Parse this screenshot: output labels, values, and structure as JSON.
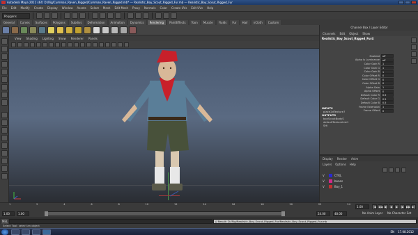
{
  "window": {
    "title": "Autodesk Maya 2011 x64: D:/Rig/Cumman_Raven_Rigged/Cumman_Raven_Rigged.mb* --- Realistic_Boy_Scout_Rigged_Fur.mb --- Realistic_Boy_Scout_Rigged_Fur",
    "controls": [
      "minimize",
      "maximize",
      "close"
    ]
  },
  "menubar": [
    "File",
    "Edit",
    "Modify",
    "Create",
    "Display",
    "Window",
    "Assets",
    "Select",
    "Mesh",
    "Edit Mesh",
    "Proxy",
    "Normals",
    "Color",
    "Create UVs",
    "Edit UVs",
    "Help"
  ],
  "status_line": {
    "menu_set": "Polygons"
  },
  "shelf": {
    "tabs": [
      "General",
      "Curves",
      "Surfaces",
      "Polygons",
      "Subdivs",
      "Deformation",
      "Animation",
      "Dynamics",
      "Rendering",
      "PaintEffects",
      "Toon",
      "Muscle",
      "Fluids",
      "Fur",
      "Hair",
      "nCloth",
      "Custom"
    ],
    "active_tab": "Rendering"
  },
  "panel_menu": [
    "View",
    "Shading",
    "Lighting",
    "Show",
    "Renderer",
    "Panels"
  ],
  "channel_box": {
    "header": "Channel Box / Layer Editor",
    "tabs": [
      "Channels",
      "Edit",
      "Object",
      "Show"
    ],
    "object_name": "Realistic_Boy_Scout_Rigged_Fur4",
    "attributes": [
      {
        "name": "Enabled",
        "value": "off"
      },
      {
        "name": "Alpha Is Luminance",
        "value": "off"
      },
      {
        "name": "Color Gain R",
        "value": "1"
      },
      {
        "name": "Color Gain G",
        "value": "1"
      },
      {
        "name": "Color Gain B",
        "value": "1"
      },
      {
        "name": "Color Offset R",
        "value": "0"
      },
      {
        "name": "Color Offset G",
        "value": "0"
      },
      {
        "name": "Color Offset B",
        "value": "0"
      },
      {
        "name": "Alpha Gain",
        "value": "1"
      },
      {
        "name": "Alpha Offset",
        "value": "0"
      },
      {
        "name": "Default Color R",
        "value": "0.5"
      },
      {
        "name": "Default Color G",
        "value": "0.5"
      },
      {
        "name": "Default Color B",
        "value": "0.5"
      },
      {
        "name": "Frame Extension",
        "value": "1"
      },
      {
        "name": "Frame Offset",
        "value": "0"
      }
    ],
    "inputs_header": "INPUTS",
    "inputs": [
      "place2dTexture7"
    ],
    "outputs_header": "OUTPUTS",
    "outputs": [
      "boyScoutBodyS",
      "defaultTextureList1",
      "SHI"
    ]
  },
  "layer_editor": {
    "tabs": [
      "Display",
      "Render",
      "Anim"
    ],
    "menu": [
      "Layers",
      "Options",
      "Help"
    ],
    "layers": [
      {
        "visible": "V",
        "color": "#2a2ad0",
        "name": "CTRL"
      },
      {
        "visible": "V",
        "color": "#d02a8a",
        "name": "bones"
      },
      {
        "visible": "V",
        "color": "#c03030",
        "name": "Boy_1"
      }
    ]
  },
  "time_slider": {
    "ticks": [
      "1",
      "2",
      "4",
      "6",
      "8",
      "10",
      "12",
      "14",
      "16",
      "18",
      "20",
      "22",
      "24"
    ],
    "current_frame": "1.00",
    "playback_buttons": [
      "|◀",
      "◀◀",
      "◀|",
      "◀",
      "▶",
      "|▶",
      "▶▶",
      "▶|"
    ]
  },
  "range_slider": {
    "start": "1.00",
    "playback_start": "1.00",
    "playback_end": "24.00",
    "end": "48.00",
    "anim_layer": "No Anim Layer",
    "character_set": "No Character Set"
  },
  "command_line": {
    "label": "MEL",
    "result": "// Result: D:/Rig/Realistic_Boy_Scout_Rigged_Fur/Realistic_Boy_Scout_Rigged_Fur.mb"
  },
  "help_line": "Select Tool: select an object",
  "taskbar": {
    "tray": "EN",
    "clock": "17.08.2012"
  },
  "colors": {
    "accent": "#2c4f86",
    "viewport_top": "#4a5a72",
    "viewport_bottom": "#2a2d33",
    "ui_bg": "#444444"
  }
}
